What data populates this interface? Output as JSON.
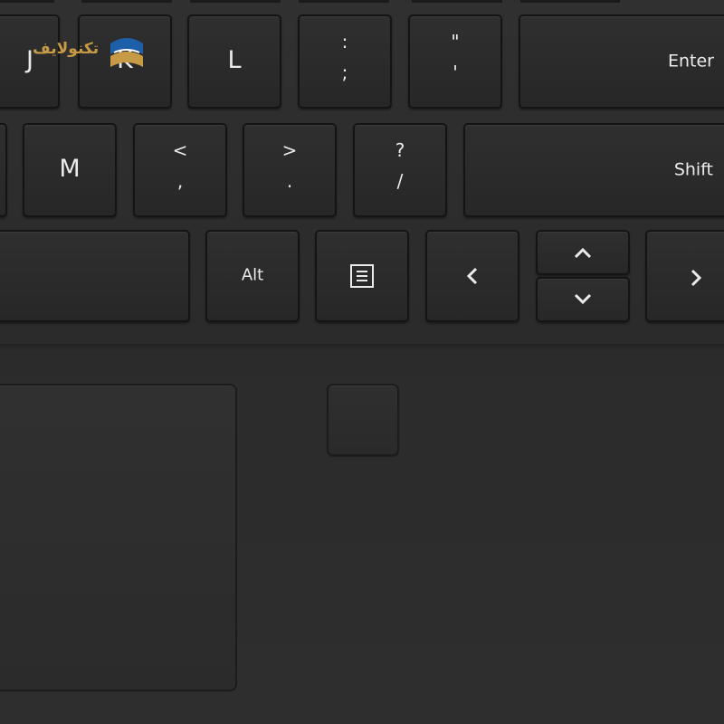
{
  "brand": {
    "watermark_text": "تکنولایف",
    "colors": {
      "gold": "#c79b45",
      "blue": "#1d5fa8"
    }
  },
  "keyboard": {
    "row1": {
      "j": "J",
      "k": "K",
      "l": "L",
      "semicolon": {
        "shift": ":",
        "base": ";"
      },
      "quote": {
        "shift": "\"",
        "base": "'"
      },
      "enter": "Enter"
    },
    "row2": {
      "m": "M",
      "comma": {
        "shift": "<",
        "base": ","
      },
      "period": {
        "shift": ">",
        "base": "."
      },
      "slash": {
        "shift": "?",
        "base": "/"
      },
      "shift": "Shift"
    },
    "row3": {
      "alt": "Alt",
      "menu_icon": "menu-icon",
      "left_icon": "chevron-left-icon",
      "up_icon": "chevron-up-icon",
      "down_icon": "chevron-down-icon",
      "right_icon": "chevron-right-icon"
    }
  },
  "colors": {
    "deck": "#2d2d2d",
    "key": "#2a2a2a",
    "legend": "#ebebeb"
  }
}
